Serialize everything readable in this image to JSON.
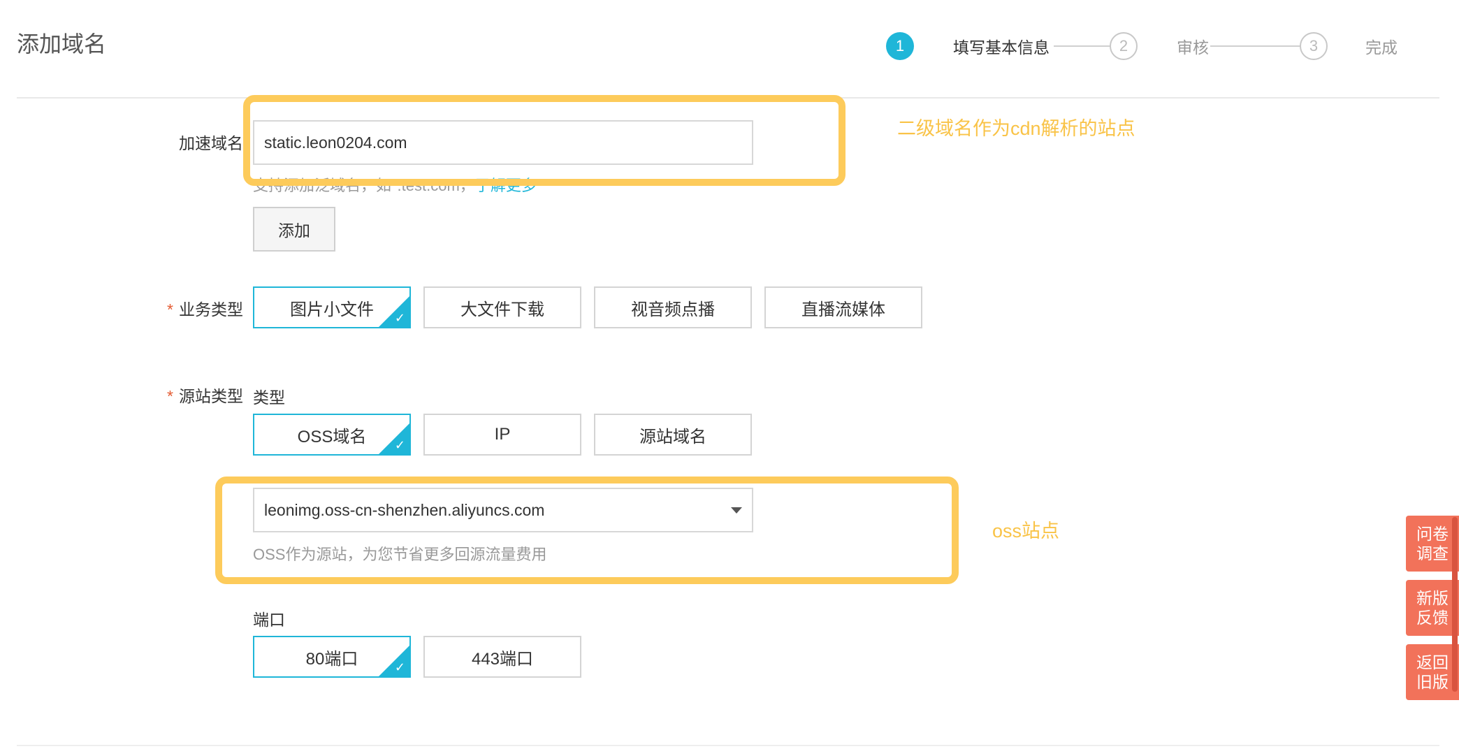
{
  "page": {
    "title": "添加域名"
  },
  "steps": [
    {
      "number": "1",
      "label": "填写基本信息",
      "state": "active"
    },
    {
      "number": "2",
      "label": "审核",
      "state": "inactive"
    },
    {
      "number": "3",
      "label": "完成",
      "state": "inactive"
    }
  ],
  "domain": {
    "label": "加速域名",
    "value": "static.leon0204.com",
    "hint_text": "支持添加泛域名，如*.test.com，",
    "hint_link": "了解更多",
    "add_button": "添加"
  },
  "business_type": {
    "label": "业务类型",
    "options": [
      "图片小文件",
      "大文件下载",
      "视音频点播",
      "直播流媒体"
    ],
    "selected": "图片小文件"
  },
  "origin": {
    "label": "源站类型",
    "type_label": "类型",
    "options": [
      "OSS域名",
      "IP",
      "源站域名"
    ],
    "selected": "OSS域名",
    "select_value": "leonimg.oss-cn-shenzhen.aliyuncs.com",
    "hint": "OSS作为源站，为您节省更多回源流量费用"
  },
  "port": {
    "label": "端口",
    "options": [
      "80端口",
      "443端口"
    ],
    "selected": "80端口"
  },
  "annotations": {
    "domain_note": "二级域名作为cdn解析的站点",
    "oss_note": "oss站点"
  },
  "side_buttons": [
    "问卷调查",
    "新版反馈",
    "返回旧版"
  ],
  "colors": {
    "accent": "#1fb6d8",
    "annotation": "#fdcb5b",
    "required": "#e45b32",
    "side_button": "#f2725a"
  }
}
